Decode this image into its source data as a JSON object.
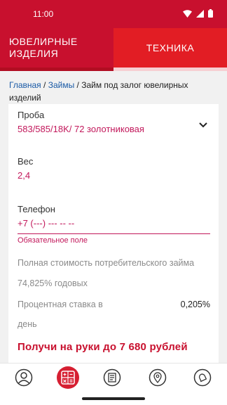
{
  "status_bar": {
    "time": "11:00"
  },
  "tabs": [
    {
      "label_line1": "ЮВЕЛИРНЫЕ",
      "label_line2": "ИЗДЕЛИЯ"
    },
    {
      "label": "ТЕХНИКА"
    }
  ],
  "breadcrumb": {
    "home": "Главная",
    "sep1": " / ",
    "loans": "Займы",
    "sep2": " / ",
    "current": "Займ под залог ювелирных изделий"
  },
  "form": {
    "proba_label": "Проба",
    "proba_value": "583/585/18K/ 72 золотниковая",
    "weight_label": "Вес",
    "weight_value": "2,4",
    "phone_label": "Телефон",
    "phone_value": "+7 (---) --- -- --",
    "required_text": "Обязательное поле"
  },
  "info": {
    "full_cost_label": "Полная стоимость потребительского займа",
    "full_cost_value": "74,825% годовых",
    "rate_label_line1": "Процентная ставка в",
    "rate_label_line2": "день",
    "rate_value": "0,205%"
  },
  "promo_text": "Получи на руки до 7 680 рублей",
  "bottom_nav": {
    "active_index": 1,
    "items": [
      "profile-icon",
      "calculator-icon",
      "document-icon",
      "location-icon",
      "bell-icon"
    ]
  },
  "colors": {
    "brand_red": "#c8102e",
    "accent_pink": "#c2185b",
    "link_blue": "#1a5aa6"
  }
}
